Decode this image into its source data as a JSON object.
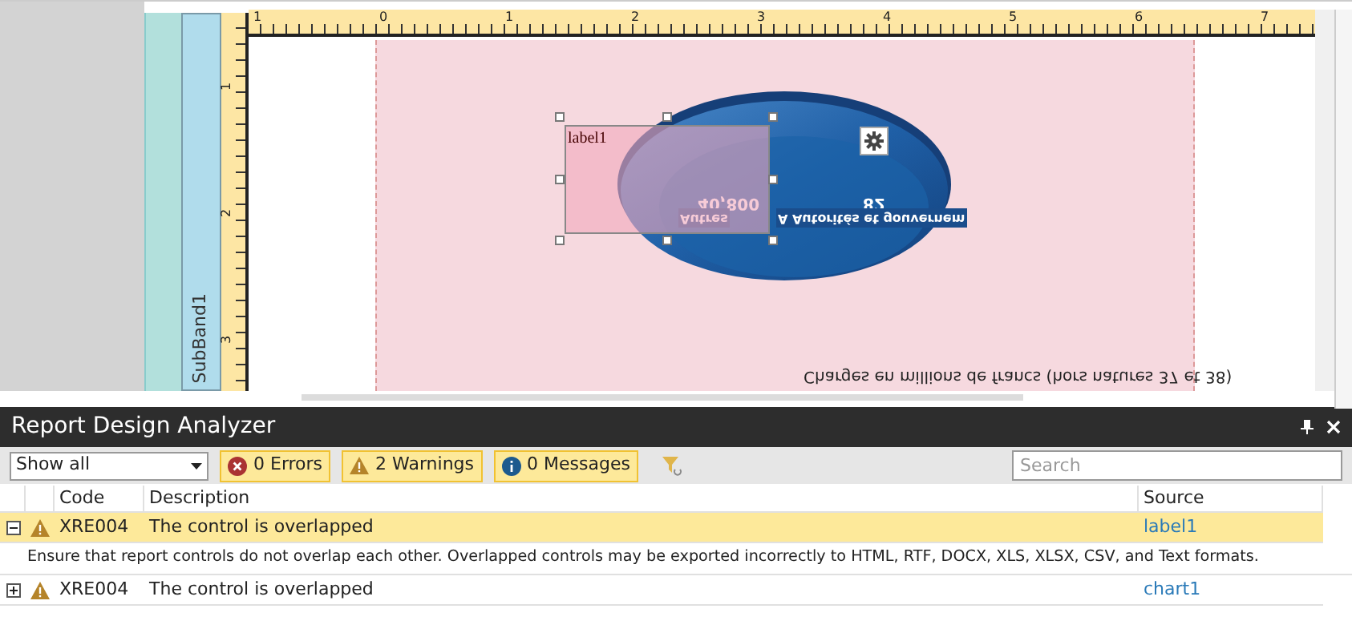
{
  "designer": {
    "band_name": "SubBand1",
    "ruler_h": [
      "1",
      "0",
      "1",
      "2",
      "3",
      "4",
      "5",
      "6",
      "7"
    ],
    "ruler_v": [
      "1",
      "2",
      "3"
    ],
    "label": {
      "text": "label1",
      "selected": true
    },
    "chart": {
      "points": [
        {
          "value": "40,800",
          "name": "Autres"
        },
        {
          "value": "82",
          "name": "A Autorités et gouvernem"
        }
      ],
      "caption": "Charges en millions de francs (hors natures 37 et 38)"
    }
  },
  "analyzer": {
    "title": "Report Design Analyzer",
    "filter": "Show all",
    "toggles": [
      {
        "kind": "error",
        "label": "0 Errors",
        "selected": true
      },
      {
        "kind": "warning",
        "label": "2 Warnings",
        "selected": true
      },
      {
        "kind": "info",
        "label": "0 Messages",
        "selected": true
      }
    ],
    "search": {
      "placeholder": "Search"
    },
    "columns": [
      "Code",
      "Description",
      "Source"
    ],
    "rows": [
      {
        "code": "XRE004",
        "description": "The control is overlapped",
        "source": "label1",
        "expanded": true,
        "selected": true,
        "details": "Ensure that report controls do not overlap each other. Overlapped controls may be exported incorrectly to HTML, RTF, DOCX, XLS, XLSX, CSV, and Text formats."
      },
      {
        "code": "XRE004",
        "description": "The control is overlapped",
        "source": "chart1",
        "expanded": false,
        "selected": false
      }
    ]
  }
}
